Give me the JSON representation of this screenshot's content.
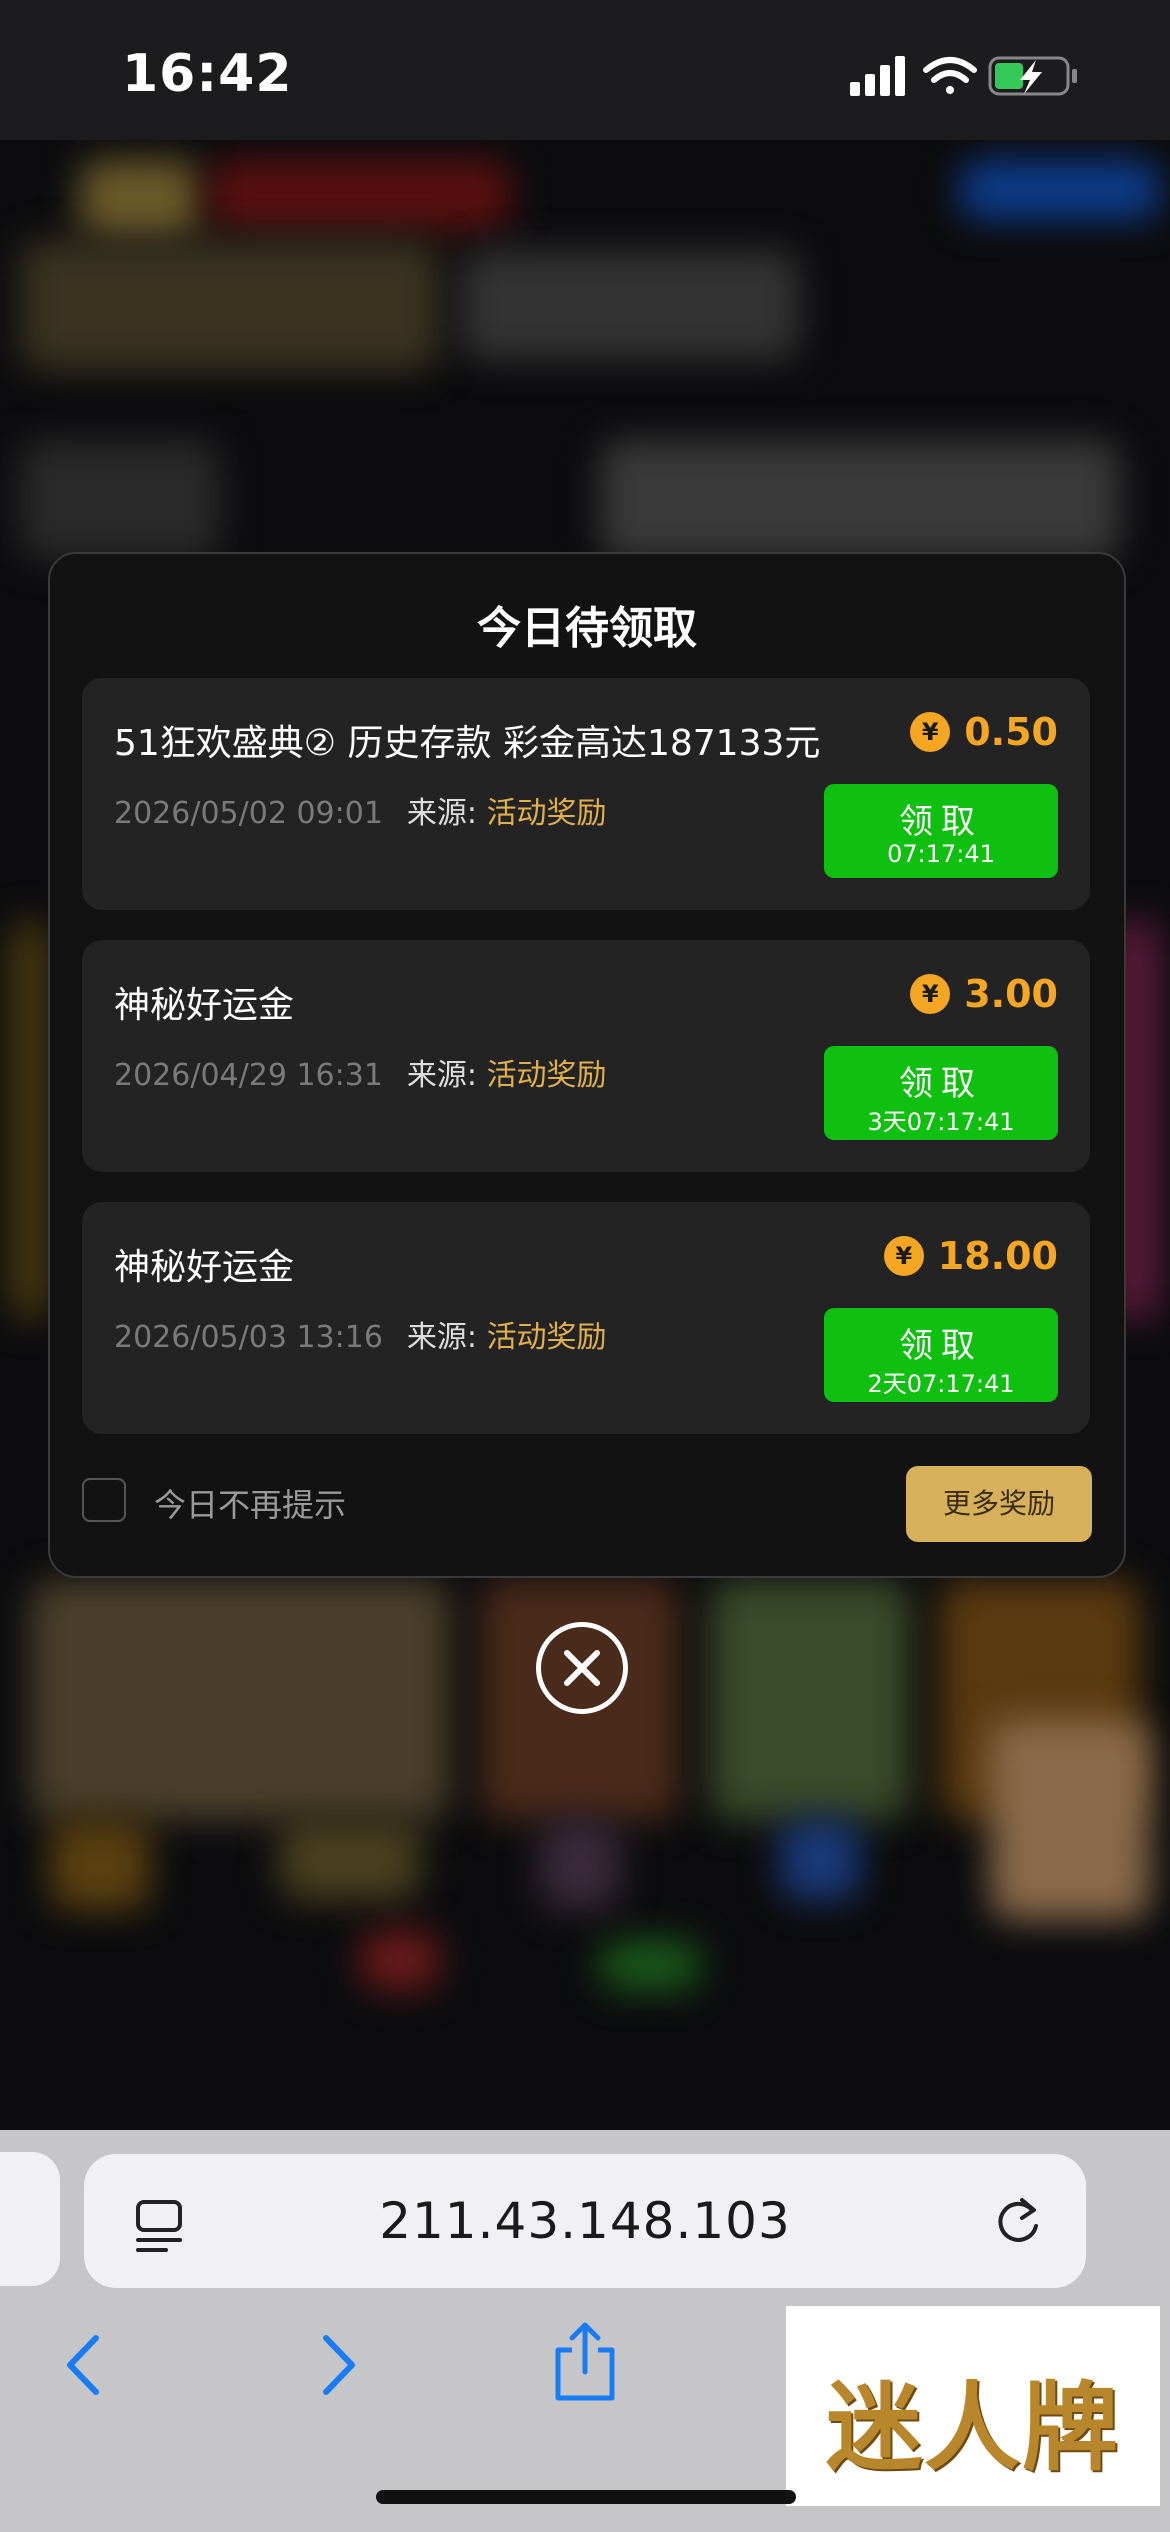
{
  "status_bar": {
    "time": "16:42"
  },
  "popup": {
    "title": "今日待领取",
    "currency_symbol": "¥",
    "items": [
      {
        "title": "51狂欢盛典② 历史存款 彩金高达187133元",
        "date": "2026/05/02 09:01",
        "source_label": "来源:",
        "source_value": "活动奖励",
        "amount": "0.50",
        "claim_label": "领取",
        "timer": "07:17:41"
      },
      {
        "title": "神秘好运金",
        "date": "2026/04/29 16:31",
        "source_label": "来源:",
        "source_value": "活动奖励",
        "amount": "3.00",
        "claim_label": "领取",
        "timer": "3天07:17:41"
      },
      {
        "title": "神秘好运金",
        "date": "2026/05/03 13:16",
        "source_label": "来源:",
        "source_value": "活动奖励",
        "amount": "18.00",
        "claim_label": "领取",
        "timer": "2天07:17:41"
      }
    ],
    "dont_show_today": "今日不再提示",
    "more_rewards": "更多奖励"
  },
  "browser": {
    "url": "211.43.148.103"
  },
  "watermark": "迷人牌",
  "colors": {
    "claim_green": "#10c010",
    "amount_orange": "#f5a623",
    "source_gold": "#e0b14a",
    "more_button": "#d6b05b"
  }
}
